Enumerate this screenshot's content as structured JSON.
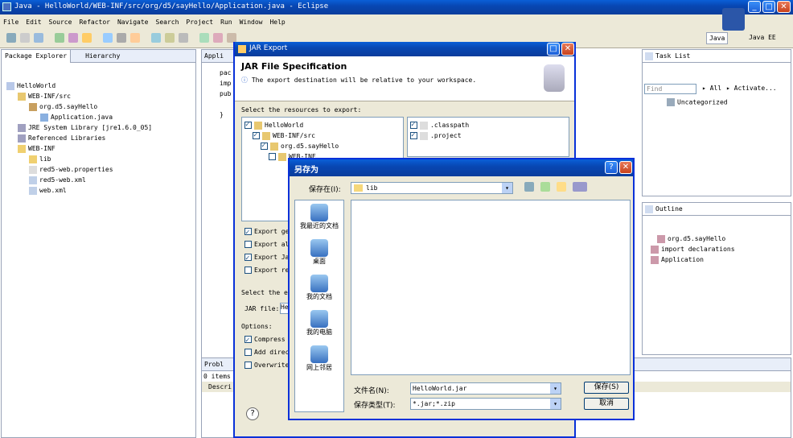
{
  "window": {
    "title": "Java - HelloWorld/WEB-INF/src/org/d5/sayHello/Application.java - Eclipse"
  },
  "menu": [
    "File",
    "Edit",
    "Source",
    "Refactor",
    "Navigate",
    "Search",
    "Project",
    "Run",
    "Window",
    "Help"
  ],
  "perspectives": {
    "java": "Java",
    "javaee": "Java EE"
  },
  "package_explorer": {
    "tab": "Package Explorer",
    "tab2": "Hierarchy",
    "tree": [
      {
        "label": "HelloWorld",
        "depth": 0,
        "icon": "project"
      },
      {
        "label": "WEB-INF/src",
        "depth": 1,
        "icon": "src-folder"
      },
      {
        "label": "org.d5.sayHello",
        "depth": 2,
        "icon": "package"
      },
      {
        "label": "Application.java",
        "depth": 3,
        "icon": "java-file"
      },
      {
        "label": "JRE System Library [jre1.6.0_05]",
        "depth": 1,
        "icon": "library"
      },
      {
        "label": "Referenced Libraries",
        "depth": 1,
        "icon": "library"
      },
      {
        "label": "WEB-INF",
        "depth": 1,
        "icon": "folder"
      },
      {
        "label": "lib",
        "depth": 2,
        "icon": "folder"
      },
      {
        "label": "red5-web.properties",
        "depth": 2,
        "icon": "file"
      },
      {
        "label": "red5-web.xml",
        "depth": 2,
        "icon": "xml-file"
      },
      {
        "label": "web.xml",
        "depth": 2,
        "icon": "xml-file"
      }
    ]
  },
  "editor": {
    "tab": "Appli",
    "lines": [
      "pac",
      "imp",
      "pub",
      "",
      "}"
    ]
  },
  "task_list": {
    "tab": "Task List",
    "find_placeholder": "Find",
    "all": "All",
    "activate": "Activate...",
    "uncategorized": "Uncategorized"
  },
  "outline": {
    "tab": "Outline",
    "items": [
      "org.d5.sayHello",
      "import declarations",
      "Application"
    ]
  },
  "problems": {
    "tab": "Probl",
    "count": "0 items",
    "desc": "Descri"
  },
  "jar_dialog": {
    "title": "JAR Export",
    "heading": "JAR File Specification",
    "info": "The export destination will be relative to your workspace.",
    "select_label": "Select the resources to export:",
    "tree": [
      {
        "label": "HelloWorld",
        "checked": true
      },
      {
        "label": "WEB-INF/src",
        "checked": true
      },
      {
        "label": "org.d5.sayHello",
        "checked": true
      },
      {
        "label": "WEB-INF",
        "checked": false
      }
    ],
    "files": [
      ".classpath",
      ".project"
    ],
    "options": [
      {
        "label": "Export ge",
        "checked": true
      },
      {
        "label": "Export al",
        "checked": false
      },
      {
        "label": "Export Ja",
        "checked": true
      },
      {
        "label": "Export re",
        "checked": false
      }
    ],
    "select_export": "Select the e",
    "jar_file": "JAR file:",
    "jar_value": "He",
    "options_label": "Options:",
    "opts2": [
      {
        "label": "Compress",
        "checked": true
      },
      {
        "label": "Add direc",
        "checked": false
      },
      {
        "label": "Overwrite",
        "checked": false
      }
    ],
    "help": "?"
  },
  "save_dialog": {
    "title": "另存为",
    "save_in_label": "保存在(I):",
    "save_in_value": "lib",
    "places": [
      "我最近的文档",
      "桌面",
      "我的文档",
      "我的电脑",
      "网上邻居"
    ],
    "filename_label": "文件名(N):",
    "filename_value": "HelloWorld.jar",
    "type_label": "保存类型(T):",
    "type_value": "*.jar;*.zip",
    "save": "保存(S)",
    "cancel": "取消"
  }
}
